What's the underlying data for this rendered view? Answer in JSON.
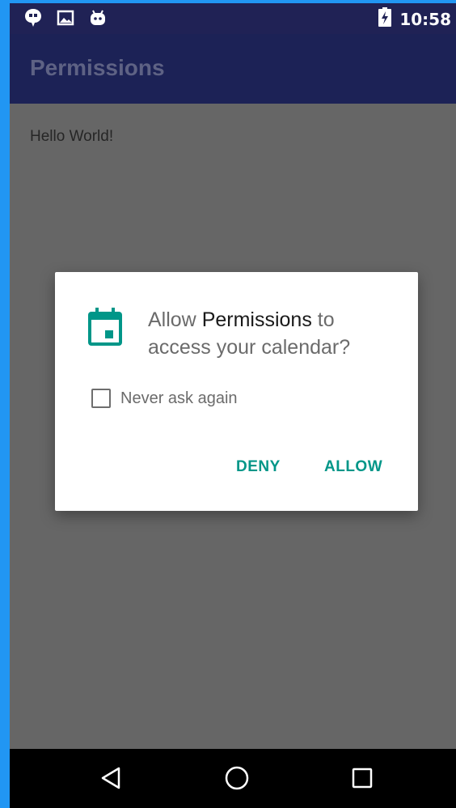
{
  "status_bar": {
    "time": "10:58",
    "notification_icons": [
      "quote-icon",
      "image-icon",
      "android-icon"
    ],
    "battery_icon": "battery-charging-icon"
  },
  "app_bar": {
    "title": "Permissions"
  },
  "content": {
    "text": "Hello World!"
  },
  "dialog": {
    "icon": "calendar-icon",
    "message_prefix": "Allow ",
    "app_name": "Permissions",
    "message_suffix": " to access your calendar?",
    "checkbox_label": "Never ask again",
    "checkbox_checked": false,
    "deny_label": "DENY",
    "allow_label": "ALLOW",
    "accent_color": "#009688"
  },
  "nav_bar": {
    "buttons": [
      "back-icon",
      "home-icon",
      "recents-icon"
    ]
  }
}
